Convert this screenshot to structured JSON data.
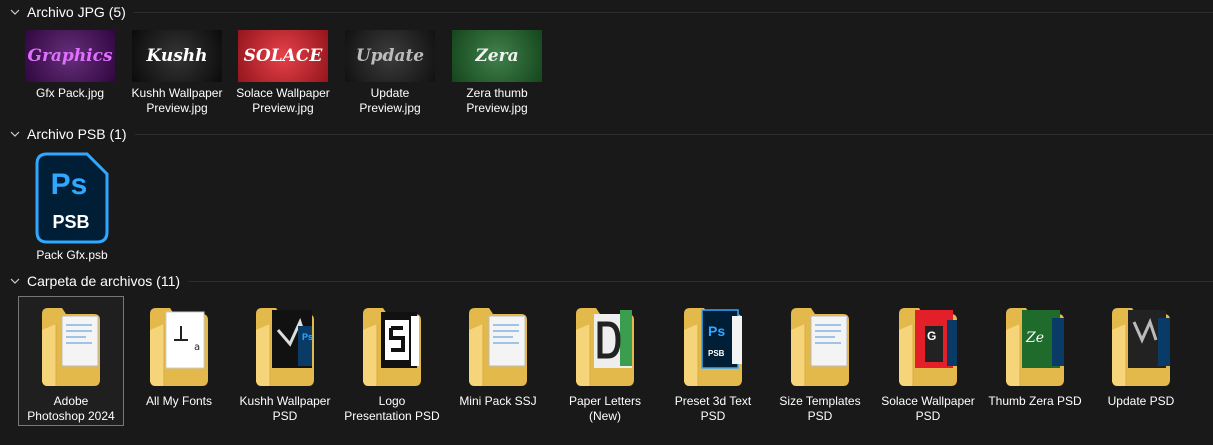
{
  "groups": [
    {
      "title": "Archivo JPG (5)"
    },
    {
      "title": "Archivo PSB (1)"
    },
    {
      "title": "Carpeta de archivos (11)"
    }
  ],
  "jpg_items": [
    {
      "label": "Gfx Pack.jpg",
      "thumb_text": "Graphics",
      "bg": "#4a0a62",
      "fg": "#e070ff"
    },
    {
      "label": "Kushh Wallpaper\nPreview.jpg",
      "thumb_text": "Kushh",
      "bg": "#111111",
      "fg": "#ffffff"
    },
    {
      "label": "Solace Wallpaper\nPreview.jpg",
      "thumb_text": "SOLACE",
      "bg": "#e3202a",
      "fg": "#ffffff"
    },
    {
      "label": "Update\nPreview.jpg",
      "thumb_text": "Update",
      "bg": "#1a1a1a",
      "fg": "#bdbdbd"
    },
    {
      "label": "Zera thumb\nPreview.jpg",
      "thumb_text": "Zera",
      "bg": "#1f6b2b",
      "fg": "#f2f2f2"
    }
  ],
  "psb_items": [
    {
      "label": "Pack Gfx.psb",
      "icon_top": "Ps",
      "icon_bottom": "PSB"
    }
  ],
  "folder_items": [
    {
      "label": "Adobe\nPhotoshop 2024",
      "preview": "docs"
    },
    {
      "label": "All My Fonts",
      "preview": "fonts"
    },
    {
      "label": "Kushh Wallpaper\nPSD",
      "preview": "kushh"
    },
    {
      "label": "Logo\nPresentation PSD",
      "preview": "logo"
    },
    {
      "label": "Mini Pack SSJ",
      "preview": "docs"
    },
    {
      "label": "Paper Letters\n(New)",
      "preview": "letters"
    },
    {
      "label": "Preset 3d Text\nPSD",
      "preview": "ps"
    },
    {
      "label": "Size Templates\nPSD",
      "preview": "docs"
    },
    {
      "label": "Solace Wallpaper\nPSD",
      "preview": "solace"
    },
    {
      "label": "Thumb Zera PSD",
      "preview": "zera"
    },
    {
      "label": "Update PSD",
      "preview": "update"
    }
  ],
  "colors": {
    "background": "#191919",
    "ps_blue": "#31a8ff",
    "ps_dark": "#001e36",
    "folder": "#f4cf6b"
  }
}
